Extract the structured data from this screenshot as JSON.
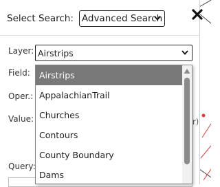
{
  "header": {
    "select_search_label": "Select Search:",
    "search_mode_value": "Advanced Search"
  },
  "form": {
    "layer_label": "Layer:",
    "layer_value": "Airstrips",
    "field_label": "Field:",
    "operator_label": "Oper.:",
    "value_label": "Value:",
    "query_label": "Query:",
    "value_hint": "r)"
  },
  "layer_dropdown": {
    "options": [
      {
        "label": "Airstrips",
        "selected": true
      },
      {
        "label": "AppalachianTrail",
        "selected": false
      },
      {
        "label": "Churches",
        "selected": false
      },
      {
        "label": "Contours",
        "selected": false
      },
      {
        "label": "County Boundary",
        "selected": false
      },
      {
        "label": "Dams",
        "selected": false
      }
    ]
  },
  "colors": {
    "selected_option_bg": "#787878",
    "map_line": "#d04040"
  },
  "icons": {
    "close": "close-icon",
    "dropdown_arrow": "chevron-down-icon"
  }
}
